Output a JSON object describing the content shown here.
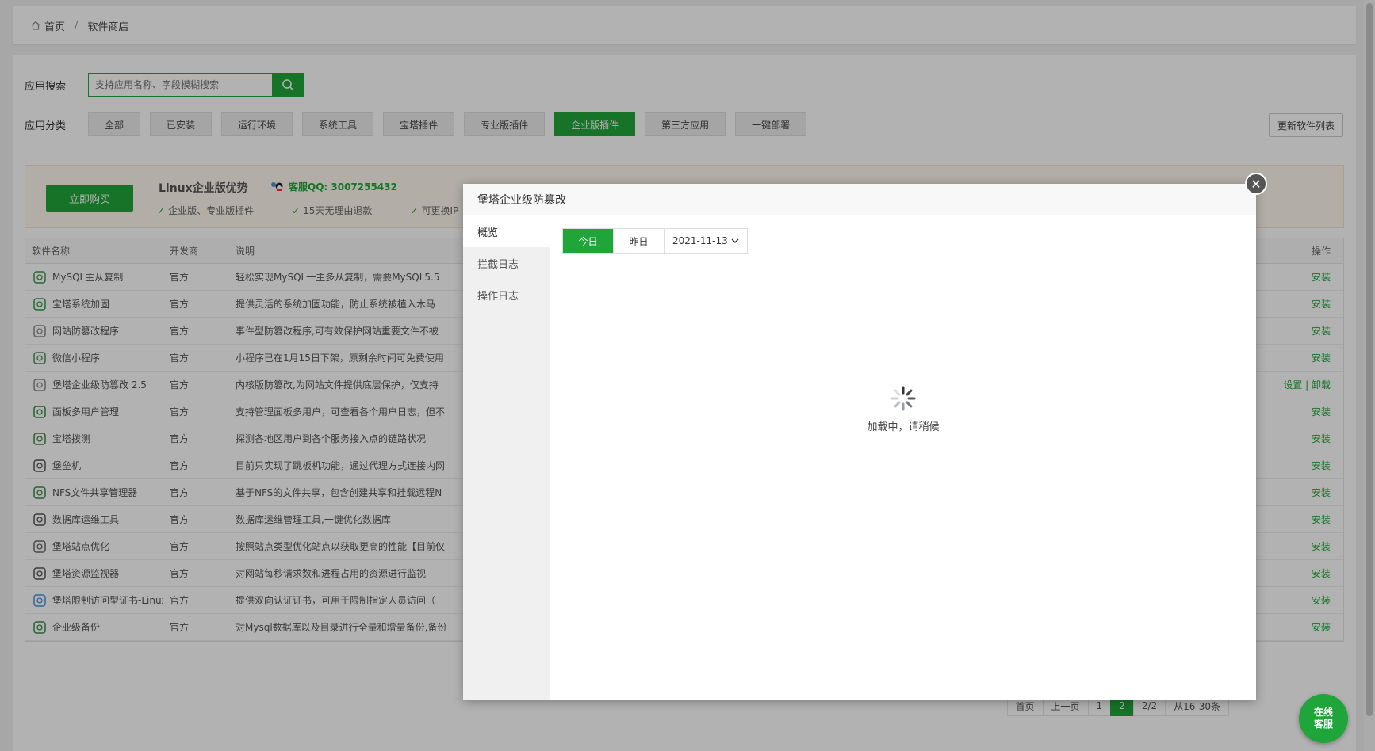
{
  "breadcrumb": {
    "home": "首页",
    "separator": "/",
    "current": "软件商店"
  },
  "search": {
    "label": "应用搜索",
    "placeholder": "支持应用名称、字段模糊搜索"
  },
  "categories": {
    "label": "应用分类",
    "items": [
      "全部",
      "已安装",
      "运行环境",
      "系统工具",
      "宝塔插件",
      "专业版插件",
      "企业版插件",
      "第三方应用",
      "一键部署"
    ],
    "active": "企业版插件"
  },
  "update_button": "更新软件列表",
  "promo": {
    "buy_label": "立即购买",
    "title": "Linux企业版优势",
    "qq": "客服QQ: 3007255432",
    "features": [
      "企业版、专业版插件",
      "15天无理由退款",
      "可更换IP"
    ]
  },
  "table": {
    "headers": {
      "name": "软件名称",
      "dev": "开发商",
      "desc": "说明",
      "op": "操作"
    },
    "rows": [
      {
        "name": "MySQL主从复制",
        "dev": "官方",
        "desc": "轻松实现MySQL一主多从复制，需要MySQL5.5",
        "op": "安装"
      },
      {
        "name": "宝塔系统加固",
        "dev": "官方",
        "desc": "提供灵活的系统加固功能，防止系统被植入木马",
        "op": "安装"
      },
      {
        "name": "网站防篡改程序",
        "dev": "官方",
        "desc": "事件型防篡改程序,可有效保护网站重要文件不被",
        "op": "安装"
      },
      {
        "name": "微信小程序",
        "dev": "官方",
        "desc": "小程序已在1月15日下架，原剩余时间可免费使用",
        "op": "安装"
      },
      {
        "name": "堡塔企业级防篡改 2.5",
        "dev": "官方",
        "desc": "内核版防篡改,为网站文件提供底层保护，仅支持",
        "op": "设置 | 卸载"
      },
      {
        "name": "面板多用户管理",
        "dev": "官方",
        "desc": "支持管理面板多用户，可查看各个用户日志，但不",
        "op": "安装"
      },
      {
        "name": "宝塔拨测",
        "dev": "官方",
        "desc": "探测各地区用户到各个服务接入点的链路状况",
        "op": "安装"
      },
      {
        "name": "堡垒机",
        "dev": "官方",
        "desc": "目前只实现了跳板机功能，通过代理方式连接内网",
        "op": "安装"
      },
      {
        "name": "NFS文件共享管理器",
        "dev": "官方",
        "desc": "基于NFS的文件共享，包含创建共享和挂载远程N",
        "op": "安装"
      },
      {
        "name": "数据库运维工具",
        "dev": "官方",
        "desc": "数据库运维管理工具,一键优化数据库",
        "op": "安装"
      },
      {
        "name": "堡塔站点优化",
        "dev": "官方",
        "desc": "按照站点类型优化站点以获取更高的性能【目前仅",
        "op": "安装"
      },
      {
        "name": "堡塔资源监视器",
        "dev": "官方",
        "desc": "对网站每秒请求数和进程占用的资源进行监视",
        "op": "安装"
      },
      {
        "name": "堡塔限制访问型证书-Linux版",
        "dev": "官方",
        "desc": "提供双向认证证书，可用于限制指定人员访问（",
        "op": "安装"
      },
      {
        "name": "企业级备份",
        "dev": "官方",
        "desc": "对Mysql数据库以及目录进行全量和增量备份,备份",
        "op": "安装"
      }
    ]
  },
  "pagination": [
    "首页",
    "上一页",
    "1",
    "2",
    "2/2",
    "从16-30条"
  ],
  "pagination_current": "2",
  "dialog": {
    "title": "堡塔企业级防篡改",
    "close_icon": "close-icon",
    "nav": [
      "概览",
      "拦截日志",
      "操作日志"
    ],
    "date_tabs": [
      "今日",
      "昨日"
    ],
    "date_value": "2021-11-13",
    "loading_text": "加载中，请稍候"
  },
  "service_button": {
    "line1": "在线",
    "line2": "客服"
  },
  "colors": {
    "accent": "#20a53a",
    "overlay": "rgba(0,0,0,0.30)"
  }
}
